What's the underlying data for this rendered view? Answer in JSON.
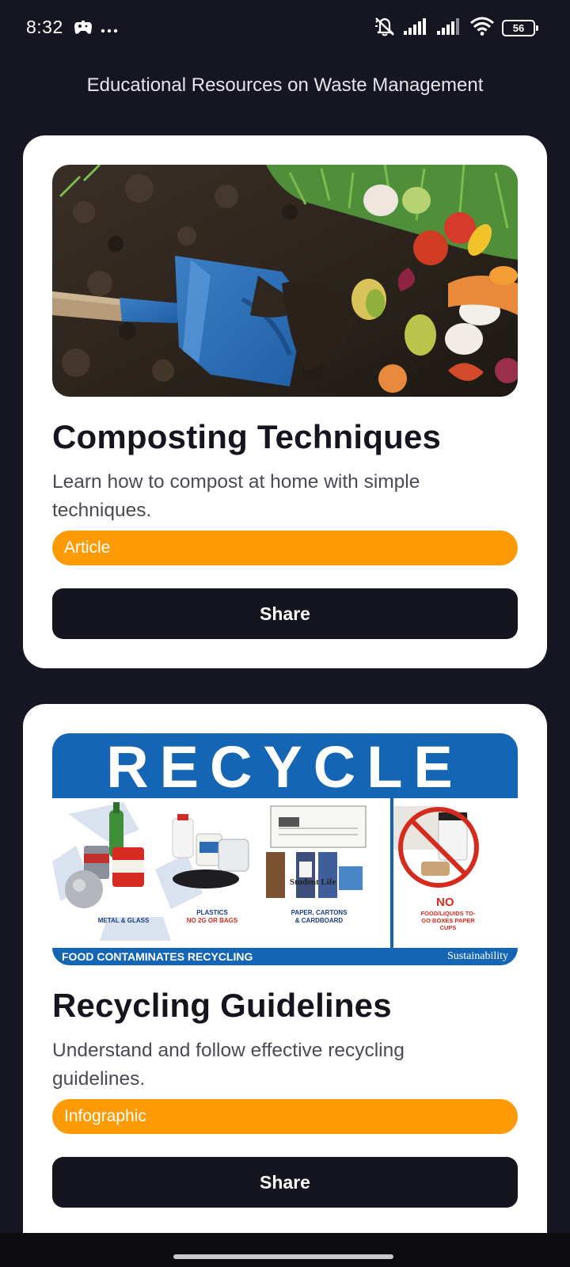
{
  "status_bar": {
    "time": "8:32",
    "battery_level": "56",
    "icons": [
      "game-controller-icon",
      "more-dots-icon",
      "mute-icon",
      "signal-icon",
      "signal-icon",
      "wifi-icon",
      "battery-icon"
    ]
  },
  "page": {
    "title": "Educational Resources on Waste Management"
  },
  "cards": [
    {
      "title": "Composting Techniques",
      "description": "Learn how to compost at home with simple techniques.",
      "type": "Article",
      "share_label": "Share"
    },
    {
      "title": "Recycling Guidelines",
      "description": "Understand and follow effective recycling guidelines.",
      "type": "Infographic",
      "share_label": "Share",
      "poster": {
        "banner": "RECYCLE",
        "newspaper": "Student Life",
        "labels": {
          "metal_glass": "METAL & GLASS",
          "plastics": "PLASTICS",
          "plastics_note": "NO 2G OR BAGS",
          "paper": "PAPER, CARTONS",
          "paper_2": "& CARDBOARD",
          "no": "NO",
          "no_note": "FOOD/LIQUIDS TO-GO BOXES PAPER CUPS"
        },
        "footer_left": "FOOD CONTAMINATES RECYCLING",
        "footer_right": "Sustainability"
      }
    }
  ],
  "colors": {
    "background": "#161622",
    "card": "#ffffff",
    "tag": "#fc9b06",
    "button": "#15151f",
    "poster_blue": "#1565b5"
  }
}
